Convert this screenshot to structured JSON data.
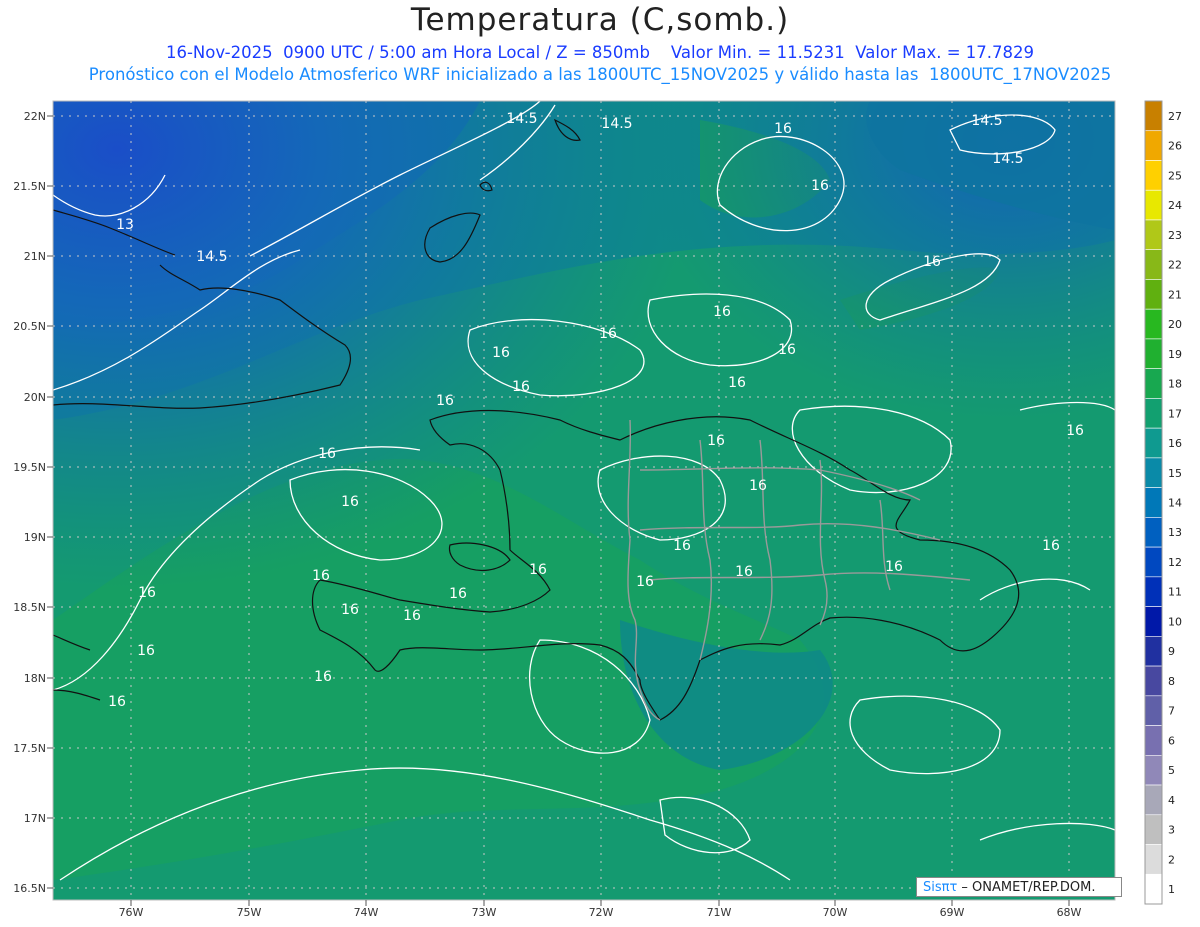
{
  "header": {
    "title": "Temperatura (C,somb.)",
    "line1": "16-Nov-2025  0900 UTC / 5:00 am Hora Local / Z = 850mb    Valor Min. = 11.5231  Valor Max. = 17.7829",
    "line2": "Pronóstico con el Modelo Atmosferico WRF inicializado a las 1800UTC_15NOV2025 y válido hasta las  1800UTC_17NOV2025"
  },
  "axes": {
    "lat_labels": [
      "22N",
      "21.5N",
      "21N",
      "20.5N",
      "20N",
      "19.5N",
      "19N",
      "18.5N",
      "18N",
      "17.5N",
      "17N",
      "16.5N"
    ],
    "lon_labels": [
      "76W",
      "75W",
      "74W",
      "73W",
      "72W",
      "71W",
      "70W",
      "69W",
      "68W"
    ]
  },
  "contour_labels": [
    "14.5",
    "14.5",
    "14.5",
    "14.5",
    "13",
    "14.5",
    "16",
    "16",
    "16",
    "16",
    "16",
    "16",
    "16",
    "16",
    "16",
    "16",
    "16",
    "16",
    "16",
    "16",
    "16",
    "16",
    "16",
    "16",
    "16",
    "16",
    "16",
    "16",
    "16",
    "16",
    "16",
    "16",
    "16",
    "16",
    "16"
  ],
  "colorbar": {
    "levels": [
      "1",
      "2",
      "3",
      "4",
      "5",
      "6",
      "7",
      "8",
      "9",
      "10",
      "11",
      "12",
      "13",
      "14",
      "15",
      "16",
      "17",
      "18",
      "19",
      "20",
      "21",
      "22",
      "23",
      "24",
      "25",
      "26",
      "27"
    ],
    "colors": [
      "#ffffff",
      "#dcdcdc",
      "#bfbfbf",
      "#a8a8b8",
      "#9088b8",
      "#7870b0",
      "#6060a8",
      "#4848a0",
      "#2030a0",
      "#0018a8",
      "#0030b8",
      "#0048c0",
      "#0060c0",
      "#0078b8",
      "#0a8aa8",
      "#0f9a90",
      "#12a070",
      "#18a850",
      "#20b030",
      "#28b820",
      "#60b010",
      "#88b818",
      "#b0c818",
      "#e8e800",
      "#ffd000",
      "#f0a800",
      "#c88000"
    ]
  },
  "credit": {
    "brand": "Sisπτ",
    "text": " – ONAMET/REP.DOM."
  }
}
